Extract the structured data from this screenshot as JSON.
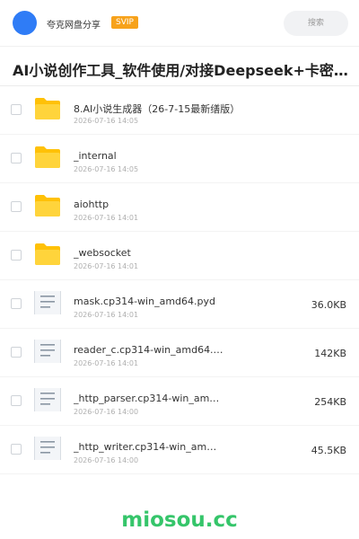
{
  "header": {
    "brand": "夸克网盘分享",
    "badge": "SVIP",
    "search_label": "搜索"
  },
  "page": {
    "title": "AI小说创作工具_软件使用/对接Deepseek+卡密生成 快…"
  },
  "files": [
    {
      "type": "folder",
      "name": "8.AI小说生成器（26-7-15最新缮版）",
      "date": "2026-07-16 14:05",
      "size": ""
    },
    {
      "type": "folder",
      "name": "_internal",
      "date": "2026-07-16 14:05",
      "size": ""
    },
    {
      "type": "folder",
      "name": "aiohttp",
      "date": "2026-07-16 14:01",
      "size": ""
    },
    {
      "type": "folder",
      "name": "_websocket",
      "date": "2026-07-16 14:01",
      "size": ""
    },
    {
      "type": "file",
      "name": "mask.cp314-win_amd64.pyd",
      "date": "2026-07-16 14:01",
      "size": "36.0KB"
    },
    {
      "type": "file",
      "name": "reader_c.cp314-win_amd64.…",
      "date": "2026-07-16 14:01",
      "size": "142KB"
    },
    {
      "type": "file",
      "name": "_http_parser.cp314-win_am…",
      "date": "2026-07-16 14:00",
      "size": "254KB"
    },
    {
      "type": "file",
      "name": "_http_writer.cp314-win_am…",
      "date": "2026-07-16 14:00",
      "size": "45.5KB"
    }
  ],
  "footer": {
    "watermark": "miosou.cc"
  },
  "colors": {
    "accent": "#2f7cf6",
    "badge": "#f7a21b",
    "folder": "#ffc107",
    "watermark": "#35c56a"
  }
}
